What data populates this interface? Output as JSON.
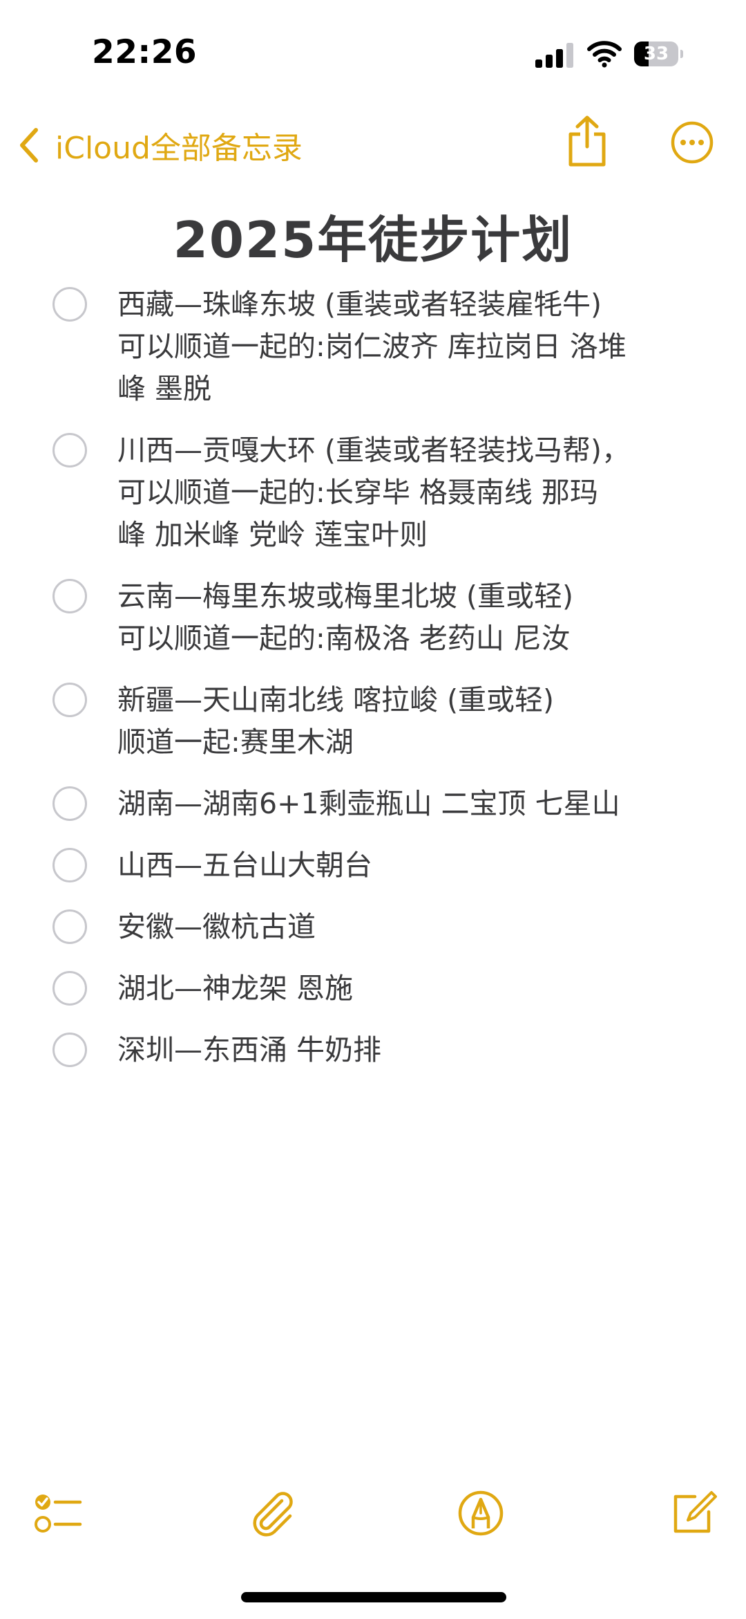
{
  "status_bar": {
    "time": "22:26",
    "battery_level": "33",
    "battery_fraction": 0.33
  },
  "nav": {
    "back_label": "iCloud全部备忘录",
    "accent_color": "#e0a812"
  },
  "note": {
    "title": "2025年徒步计划",
    "items": [
      {
        "checked": false,
        "lines": [
          "西藏—珠峰东坡 (重装或者轻装雇牦牛)",
          "可以顺道一起的:岗仁波齐 库拉岗日  洛堆",
          "峰  墨脱"
        ]
      },
      {
        "checked": false,
        "lines": [
          "川西—贡嘎大环 (重装或者轻装找马帮)，",
          "可以顺道一起的:长穿毕  格聂南线  那玛",
          "峰 加米峰  党岭 莲宝叶则"
        ]
      },
      {
        "checked": false,
        "lines": [
          "云南—梅里东坡或梅里北坡 (重或轻)",
          "可以顺道一起的:南极洛  老药山  尼汝"
        ]
      },
      {
        "checked": false,
        "lines": [
          "新疆—天山南北线 喀拉峻 (重或轻)",
          "顺道一起:赛里木湖"
        ]
      },
      {
        "checked": false,
        "lines": [
          "湖南—湖南6+1剩壶瓶山  二宝顶 七星山"
        ]
      },
      {
        "checked": false,
        "lines": [
          "山西—五台山大朝台"
        ]
      },
      {
        "checked": false,
        "lines": [
          "安徽—徽杭古道"
        ]
      },
      {
        "checked": false,
        "lines": [
          "湖北—神龙架  恩施"
        ]
      },
      {
        "checked": false,
        "lines": [
          "深圳—东西涌 牛奶排"
        ]
      }
    ]
  },
  "toolbar": {
    "icons": [
      "checklist-icon",
      "paperclip-icon",
      "markup-pen-icon",
      "compose-icon"
    ]
  }
}
